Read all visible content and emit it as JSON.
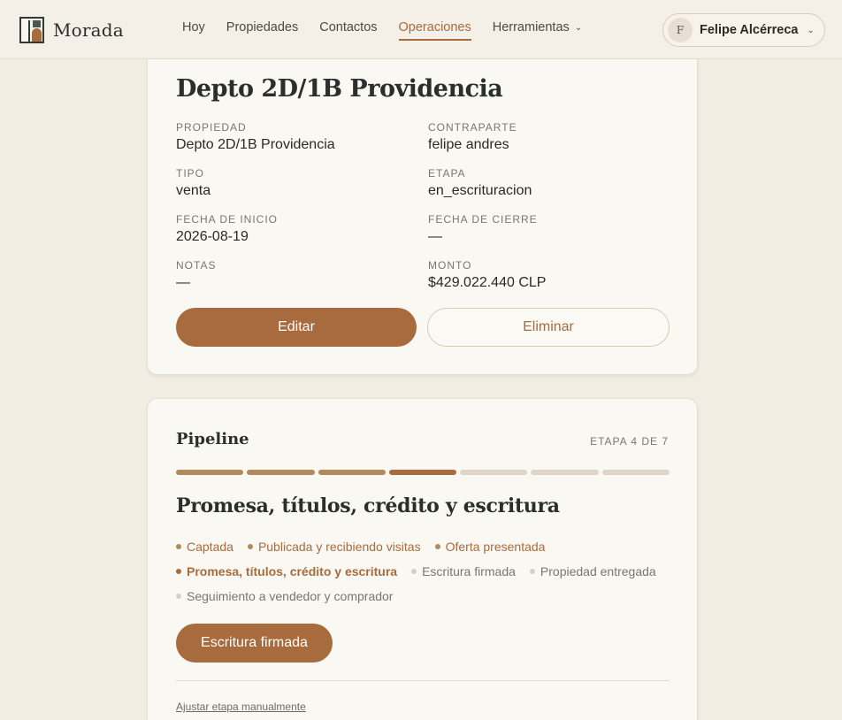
{
  "header": {
    "brand": "Morada",
    "nav": [
      {
        "label": "Hoy",
        "active": false
      },
      {
        "label": "Propiedades",
        "active": false
      },
      {
        "label": "Contactos",
        "active": false
      },
      {
        "label": "Operaciones",
        "active": true
      },
      {
        "label": "Herramientas",
        "active": false,
        "has_dropdown": true
      }
    ],
    "user": {
      "initial": "F",
      "name": "Felipe Alcérreca"
    }
  },
  "operation": {
    "title": "Depto 2D/1B Providencia",
    "fields": {
      "propiedad": {
        "label": "PROPIEDAD",
        "value": "Depto 2D/1B Providencia"
      },
      "contraparte": {
        "label": "CONTRAPARTE",
        "value": "felipe andres"
      },
      "tipo": {
        "label": "TIPO",
        "value": "venta"
      },
      "etapa": {
        "label": "ETAPA",
        "value": "en_escrituracion"
      },
      "fecha_inicio": {
        "label": "FECHA DE INICIO",
        "value": "2026-08-19"
      },
      "fecha_cierre": {
        "label": "FECHA DE CIERRE",
        "value": "—"
      },
      "notas": {
        "label": "NOTAS",
        "value": "—"
      },
      "monto": {
        "label": "MONTO",
        "value": "$429.022.440 CLP"
      }
    },
    "edit_label": "Editar",
    "delete_label": "Eliminar"
  },
  "pipeline": {
    "title": "Pipeline",
    "stage_count": "ETAPA 4 DE 7",
    "current_stage": 4,
    "total_stages": 7,
    "current_heading": "Promesa, títulos, crédito y escritura",
    "stages": [
      {
        "label": "Captada",
        "status": "done"
      },
      {
        "label": "Publicada y recibiendo visitas",
        "status": "done"
      },
      {
        "label": "Oferta presentada",
        "status": "done"
      },
      {
        "label": "Promesa, títulos, crédito y escritura",
        "status": "current"
      },
      {
        "label": "Escritura firmada",
        "status": "pending"
      },
      {
        "label": "Propiedad entregada",
        "status": "pending"
      },
      {
        "label": "Seguimiento a vendedor y comprador",
        "status": "pending"
      }
    ],
    "next_button": "Escritura firmada",
    "manual_link": "Ajustar etapa manualmente"
  },
  "colors": {
    "accent": "#a86b3d",
    "background": "#f2ede3",
    "card": "#faf8f2"
  }
}
